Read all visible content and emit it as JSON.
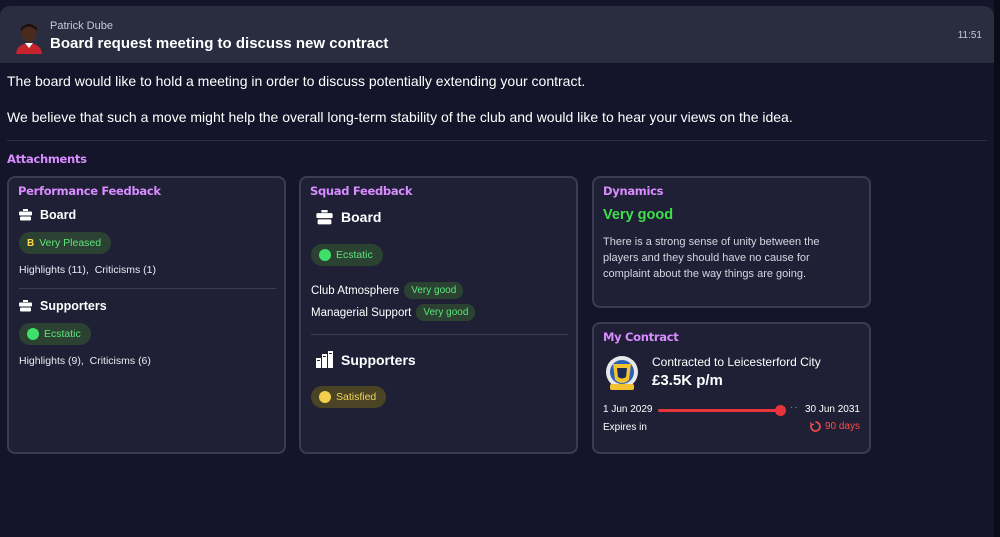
{
  "message": {
    "sender": "Patrick Dube",
    "subject": "Board request meeting to discuss new contract",
    "time": "11:51",
    "paragraphs": [
      "The board would like to hold a meeting in order to discuss potentially extending your contract.",
      "We believe that such a move might help the overall long-term stability of the club and would like to hear your views on the idea."
    ]
  },
  "attachments_title": "Attachments",
  "performance": {
    "title": "Performance Feedback",
    "board": {
      "label": "Board",
      "grade": "B",
      "status": "Very Pleased",
      "highlights_label": "Highlights",
      "highlights": "(11)",
      "criticisms_label": "Criticisms",
      "criticisms": "(1)"
    },
    "supporters": {
      "label": "Supporters",
      "status": "Ecstatic",
      "highlights_label": "Highlights",
      "highlights": "(9)",
      "criticisms_label": "Criticisms",
      "criticisms": "(6)"
    }
  },
  "squad": {
    "title": "Squad Feedback",
    "board_label": "Board",
    "board_status": "Ecstatic",
    "club_atmosphere_label": "Club Atmosphere",
    "club_atmosphere_value": "Very good",
    "managerial_support_label": "Managerial Support",
    "managerial_support_value": "Very good",
    "supporters_label": "Supporters",
    "supporters_status": "Satisfied"
  },
  "dynamics": {
    "title": "Dynamics",
    "rating": "Very good",
    "description": "There is a strong sense of unity between the players and they should have no cause for complaint about the way things are going."
  },
  "contract": {
    "title": "My Contract",
    "club_label": "Contracted to Leicesterford City",
    "wage": "£3.5K p/m",
    "start_date": "1 Jun 2029",
    "end_date": "30 Jun 2031",
    "expires_label": "Expires in",
    "expires_value": "90 days"
  },
  "colors": {
    "accent_purple": "#d98cff",
    "positive_green": "#3fe04a",
    "warning_yellow": "#f2cf4c",
    "danger_red": "#e8353b"
  }
}
